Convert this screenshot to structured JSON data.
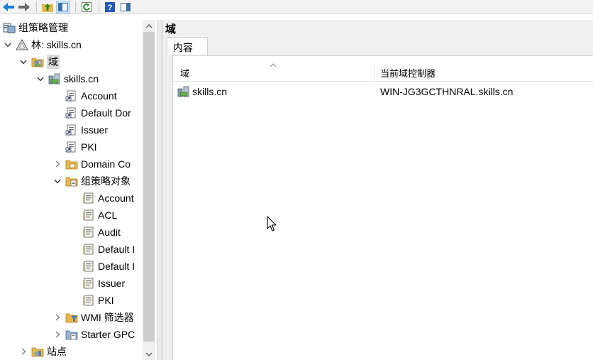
{
  "tree": {
    "items": [
      {
        "label": "组策略管理",
        "icon": "gpm-console-icon",
        "expander": "",
        "level": 0
      },
      {
        "label": "林: skills.cn",
        "icon": "forest-icon",
        "expander": "expanded",
        "level": 0
      },
      {
        "label": "域",
        "icon": "domains-folder-icon",
        "expander": "expanded",
        "level": 1,
        "selected": true
      },
      {
        "label": "skills.cn",
        "icon": "domain-icon",
        "expander": "expanded",
        "level": 2
      },
      {
        "label": "Account",
        "icon": "gpo-link-icon",
        "expander": "",
        "level": 3
      },
      {
        "label": "Default Dor",
        "icon": "gpo-link-icon",
        "expander": "",
        "level": 3
      },
      {
        "label": "Issuer",
        "icon": "gpo-link-icon",
        "expander": "",
        "level": 3
      },
      {
        "label": "PKI",
        "icon": "gpo-link-icon",
        "expander": "",
        "level": 3
      },
      {
        "label": "Domain Co",
        "icon": "ou-icon",
        "expander": "collapsed",
        "level": 3
      },
      {
        "label": "组策略对象",
        "icon": "gpo-folder-icon",
        "expander": "expanded",
        "level": 3
      },
      {
        "label": "Account",
        "icon": "gpo-icon",
        "expander": "",
        "level": 4
      },
      {
        "label": "ACL",
        "icon": "gpo-icon",
        "expander": "",
        "level": 4
      },
      {
        "label": "Audit",
        "icon": "gpo-icon",
        "expander": "",
        "level": 4
      },
      {
        "label": "Default I",
        "icon": "gpo-icon",
        "expander": "",
        "level": 4
      },
      {
        "label": "Default I",
        "icon": "gpo-icon",
        "expander": "",
        "level": 4
      },
      {
        "label": "Issuer",
        "icon": "gpo-icon",
        "expander": "",
        "level": 4
      },
      {
        "label": "PKI",
        "icon": "gpo-icon",
        "expander": "",
        "level": 4
      },
      {
        "label": "WMI 筛选器",
        "icon": "wmi-filter-folder-icon",
        "expander": "collapsed",
        "level": 3
      },
      {
        "label": "Starter GPC",
        "icon": "starter-gpo-folder-icon",
        "expander": "collapsed",
        "level": 3
      },
      {
        "label": "站点",
        "icon": "sites-icon",
        "expander": "collapsed",
        "level": 1
      }
    ]
  },
  "right": {
    "title": "域",
    "tab_label": "内容",
    "columns": [
      "域",
      "当前域控制器"
    ],
    "rows": [
      {
        "domain": "skills.cn",
        "dc": "WIN-JG3GCTHNRAL.skills.cn"
      }
    ]
  },
  "colors": {
    "selection": "#d9d9d9",
    "toolbar_blue": "#1e7bd8",
    "folder_yellow": "#e8b84a",
    "scrollbar_thumb": "#cdcdcd"
  }
}
